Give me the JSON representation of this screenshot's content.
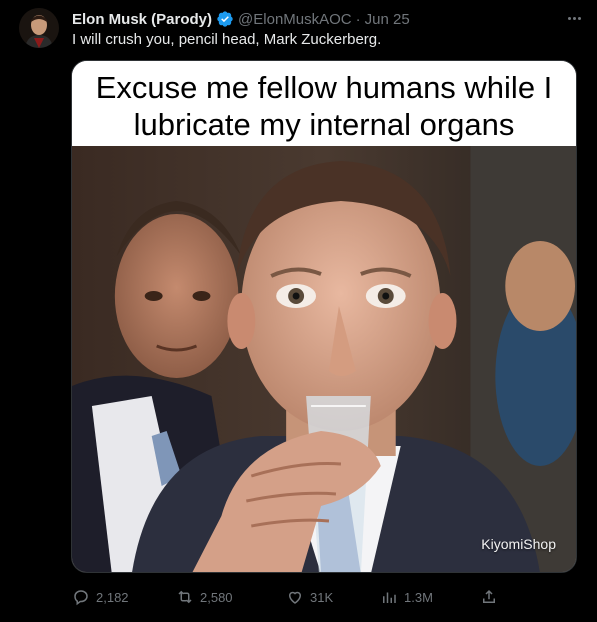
{
  "author": {
    "name": "Elon Musk (Parody)",
    "handle": "@ElonMuskAOC",
    "separator": "·",
    "time": "Jun 25"
  },
  "tweet_text": "I will crush you, pencil head, Mark Zuckerberg.",
  "media": {
    "caption_line1": "Excuse me fellow humans while I",
    "caption_line2": "lubricate my internal organs",
    "watermark": "KiyomiShop"
  },
  "actions": {
    "replies": "2,182",
    "reposts": "2,580",
    "likes": "31K",
    "views": "1.3M"
  },
  "colors": {
    "background": "#000000",
    "text": "#e7e9ea",
    "muted": "#71767b",
    "verified": "#1d9bf0"
  }
}
